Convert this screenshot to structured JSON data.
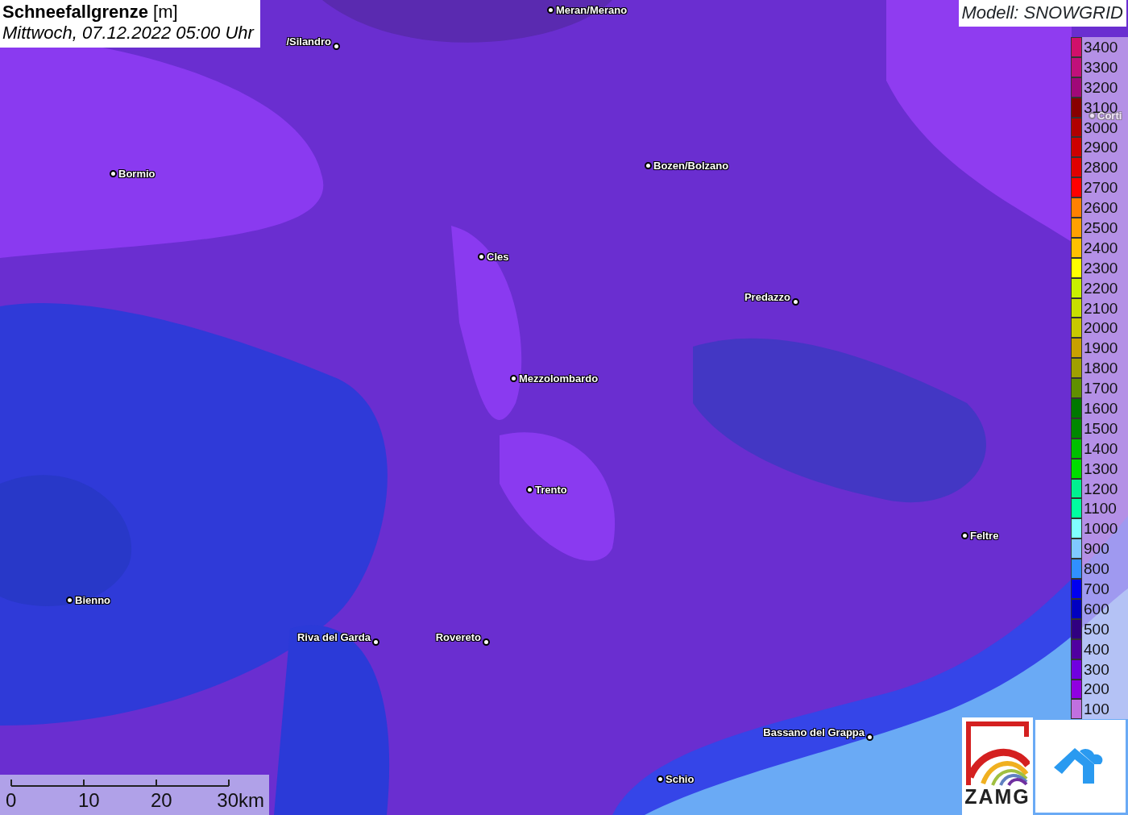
{
  "title": {
    "name": "Schneefallgrenze",
    "unit": "[m]",
    "date": "Mittwoch, 07.12.2022 05:00 Uhr"
  },
  "model": "Modell: SNOWGRID",
  "places": [
    {
      "name": "Meran/Merano"
    },
    {
      "name": "/Silandro"
    },
    {
      "name": "Bormio"
    },
    {
      "name": "Bozen/Bolzano"
    },
    {
      "name": "Cles"
    },
    {
      "name": "Predazzo"
    },
    {
      "name": "Mezzolombardo"
    },
    {
      "name": "Trento"
    },
    {
      "name": "Feltre"
    },
    {
      "name": "Bienno"
    },
    {
      "name": "Riva del Garda"
    },
    {
      "name": "Rovereto"
    },
    {
      "name": "Bassano del Grappa"
    },
    {
      "name": "Schio"
    },
    {
      "name": "Corti"
    }
  ],
  "legend": [
    {
      "label": "3400",
      "color": "#d0106a"
    },
    {
      "label": "3300",
      "color": "#c0107a"
    },
    {
      "label": "3200",
      "color": "#a00878"
    },
    {
      "label": "3100",
      "color": "#880000"
    },
    {
      "label": "3000",
      "color": "#b00000"
    },
    {
      "label": "2900",
      "color": "#cc0000"
    },
    {
      "label": "2800",
      "color": "#e00000"
    },
    {
      "label": "2700",
      "color": "#ff0000"
    },
    {
      "label": "2600",
      "color": "#ff8000"
    },
    {
      "label": "2500",
      "color": "#ffa000"
    },
    {
      "label": "2400",
      "color": "#ffc000"
    },
    {
      "label": "2300",
      "color": "#ffff00"
    },
    {
      "label": "2200",
      "color": "#c8f000"
    },
    {
      "label": "2100",
      "color": "#c8e000"
    },
    {
      "label": "2000",
      "color": "#c8c800"
    },
    {
      "label": "1900",
      "color": "#c8a000"
    },
    {
      "label": "1800",
      "color": "#a0a000"
    },
    {
      "label": "1700",
      "color": "#609000"
    },
    {
      "label": "1600",
      "color": "#007800"
    },
    {
      "label": "1500",
      "color": "#008800"
    },
    {
      "label": "1400",
      "color": "#00c000"
    },
    {
      "label": "1300",
      "color": "#00dd00"
    },
    {
      "label": "1200",
      "color": "#00f090"
    },
    {
      "label": "1100",
      "color": "#00ffa0"
    },
    {
      "label": "1000",
      "color": "#80ffff"
    },
    {
      "label": "900",
      "color": "#80c8ff"
    },
    {
      "label": "800",
      "color": "#3090ff"
    },
    {
      "label": "700",
      "color": "#0000f0"
    },
    {
      "label": "600",
      "color": "#0000c0"
    },
    {
      "label": "500",
      "color": "#300080"
    },
    {
      "label": "400",
      "color": "#5000a0"
    },
    {
      "label": "300",
      "color": "#7000e0"
    },
    {
      "label": "200",
      "color": "#9000e0"
    },
    {
      "label": "100",
      "color": "#c070e0"
    }
  ],
  "scale": [
    "0",
    "10",
    "20",
    "30km"
  ],
  "logos": {
    "left": "ZAMG"
  }
}
